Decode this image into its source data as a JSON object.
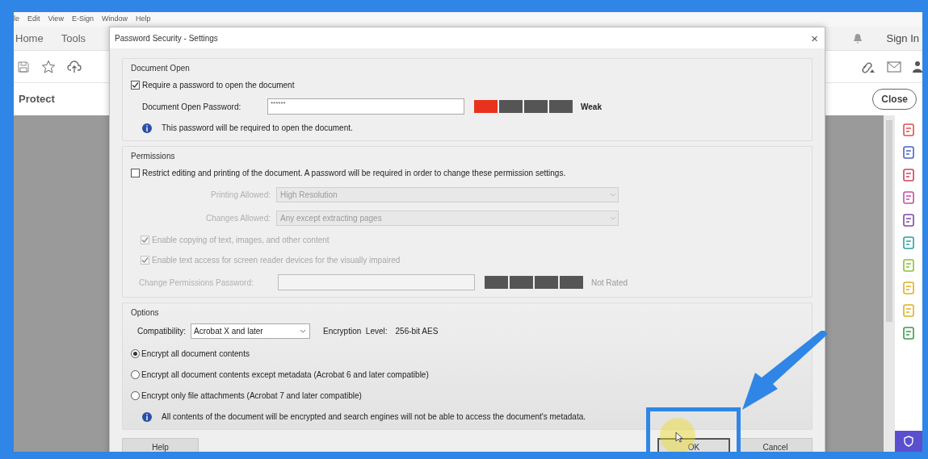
{
  "menu_bar": [
    "le",
    "Edit",
    "View",
    "E-Sign",
    "Window",
    "Help"
  ],
  "tabs": [
    {
      "label": "Home"
    },
    {
      "label": "Tools"
    }
  ],
  "sign_in": "Sign In",
  "panel_title": "Protect",
  "close_button": "Close",
  "dialog": {
    "title": "Password Security - Settings",
    "close": "×",
    "document_open": {
      "heading": "Document Open",
      "require": {
        "label": "Require a password to open the document",
        "checked": true
      },
      "password_label": "Document Open Password:",
      "password_value": "******",
      "strength": {
        "level": 0.25,
        "reading": "Weak"
      },
      "info": "This password will be required to open the document."
    },
    "permissions": {
      "heading": "Permissions",
      "restrict": {
        "label": "Restrict editing and printing of the document. A password will be required in order to change these permission settings.",
        "checked": false
      },
      "selects": [
        {
          "label": "Printing Allowed:",
          "value": "High Resolution",
          "disabled": true
        },
        {
          "label": "Changes Allowed:",
          "value": "Any except extracting pages",
          "disabled": true
        }
      ],
      "checks": [
        {
          "label": "Enable copying of text, images, and other content",
          "checked": true,
          "disabled": true
        },
        {
          "label": "Enable text access for screen reader devices for the visually impaired",
          "checked": true,
          "disabled": true
        }
      ],
      "password_label": "Change Permissions Password:",
      "disabled": true,
      "strength": {
        "reading": "Not Rated"
      }
    },
    "options": {
      "heading": "Options",
      "compatibility_label": "Compatibility:",
      "compatibility_value": "Acrobat X and later",
      "encryption_label": "Encryption  Level:",
      "encryption_value": "256-bit AES",
      "radios": [
        {
          "label": "Encrypt all document contents",
          "selected": true
        },
        {
          "label": "Encrypt all document contents except metadata (Acrobat 6 and later compatible)",
          "selected": false
        },
        {
          "label": "Encrypt only file attachments (Acrobat 7 and later compatible)",
          "selected": false
        }
      ],
      "info": "All contents of the document will be encrypted and search engines will not be able to access the document's metadata."
    },
    "buttons": [
      {
        "label": "Help"
      },
      {
        "label": "OK"
      },
      {
        "label": "Cancel"
      }
    ]
  }
}
